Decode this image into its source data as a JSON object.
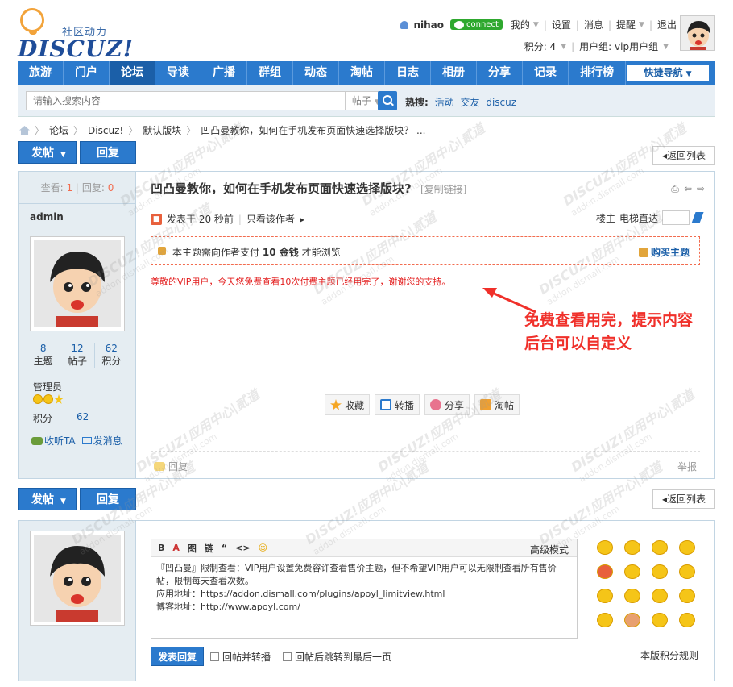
{
  "logo": {
    "sub": "社区动力",
    "main": "DISCUZ!"
  },
  "user": {
    "name": "nihao",
    "connect": "connect",
    "links": [
      "我的",
      "设置",
      "消息",
      "提醒",
      "退出"
    ],
    "credits": "积分: 4",
    "group": "用户组: vip用户组"
  },
  "nav": {
    "items": [
      "旅游",
      "门户",
      "论坛",
      "导读",
      "广播",
      "群组",
      "动态",
      "淘帖",
      "日志",
      "相册",
      "分享",
      "记录",
      "排行榜"
    ],
    "active": "论坛",
    "quick": "快捷导航"
  },
  "search": {
    "placeholder": "请输入搜索内容",
    "type": "帖子",
    "hot_label": "热搜:",
    "hot": [
      "活动",
      "交友",
      "discuz"
    ]
  },
  "breadcrumb": [
    "论坛",
    "Discuz!",
    "默认版块",
    "凹凸曼教你，如何在手机发布页面快速选择版块？ ..."
  ],
  "buttons": {
    "post": "发帖",
    "reply": "回复",
    "back": "返回列表"
  },
  "thread": {
    "views_label": "查看:",
    "views": "1",
    "replies_label": "回复:",
    "replies": "0",
    "title": "凹凸曼教你，如何在手机发布页面快速选择版块?",
    "copy_link": "[复制链接]",
    "author": "admin",
    "stats": [
      {
        "num": "8",
        "label": "主题"
      },
      {
        "num": "12",
        "label": "帖子"
      },
      {
        "num": "62",
        "label": "积分"
      }
    ],
    "group": "管理员",
    "credit_label": "积分",
    "credit": "62",
    "follow": "收听TA",
    "message": "发消息",
    "posted": "发表于 20 秒前",
    "only_author": "只看该作者",
    "floor_label": "楼主",
    "elevator": "电梯直达",
    "pay_text_pre": "本主题需向作者支付",
    "pay_amount": "10 金钱",
    "pay_text_post": "才能浏览",
    "buy": "购买主题",
    "vip_msg": "尊敬的VIP用户，今天您免费查看10次付费主题已经用完了，谢谢您的支持。",
    "annotation_1": "免费查看用完，提示内容",
    "annotation_2": "后台可以自定义",
    "actions": [
      "收藏",
      "转播",
      "分享",
      "淘帖"
    ],
    "reply": "回复",
    "report": "举报"
  },
  "quick_reply": {
    "toolbar": [
      "B",
      "A",
      "图",
      "链",
      "“",
      "<>",
      "☺"
    ],
    "advanced": "高级模式",
    "body_1": "『凹凸曼』限制查看：VIP用户设置免费容许查看售价主题，但不希望VIP用户可以无限制查看所有售价帖，限制每天查看次数。",
    "body_2": "应用地址：https://addon.dismall.com/plugins/apoyl_limitview.html",
    "body_3": "博客地址：http://www.apoyl.com/",
    "submit": "发表回复",
    "opt1": "回帖并转播",
    "opt2": "回帖后跳转到最后一页",
    "rules": "本版积分规则"
  },
  "watermark": {
    "brand": "DISCUZ!应用中心|贰道",
    "url": "addon.dismall.com"
  },
  "colors": {
    "nav": "#2b7acd",
    "accent": "#f0302a",
    "side": "#e5edf2"
  }
}
